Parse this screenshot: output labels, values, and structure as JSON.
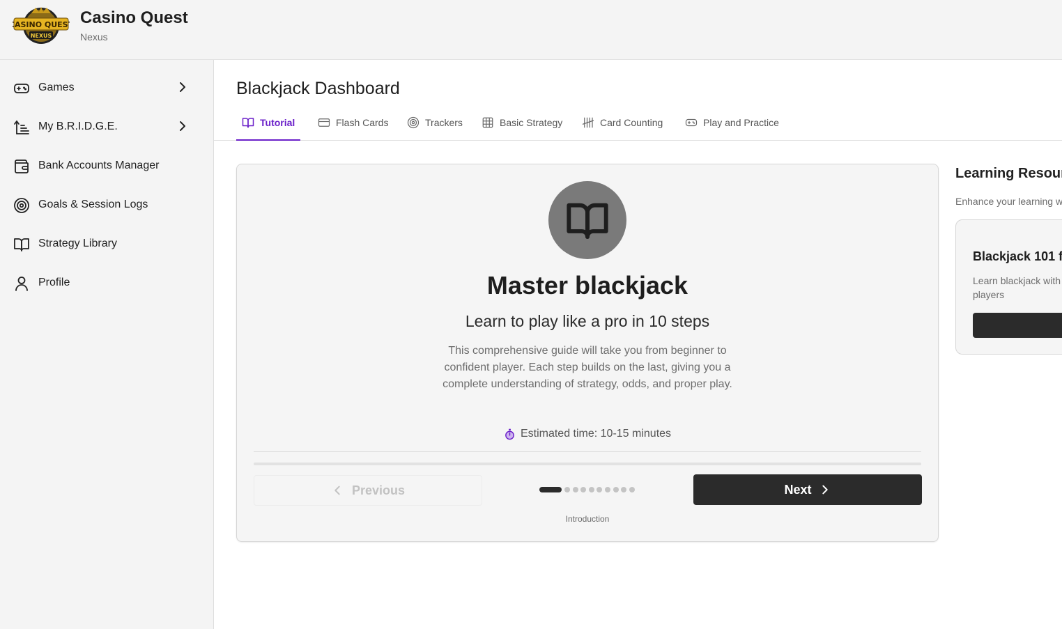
{
  "header": {
    "title": "Casino Quest",
    "subtitle": "Nexus",
    "logo_icon": "casino-quest-logo",
    "logo_text_top": "CASINO QUEST",
    "logo_text_bottom": "NEXUS"
  },
  "sidebar": {
    "items": [
      {
        "label": "Games",
        "icon": "gamepad-icon",
        "has_submenu": true
      },
      {
        "label": "My B.R.I.D.G.E.",
        "icon": "bridge-icon",
        "has_submenu": true
      },
      {
        "label": "Bank Accounts Manager",
        "icon": "wallet-icon",
        "has_submenu": false
      },
      {
        "label": "Goals & Session Logs",
        "icon": "target-icon",
        "has_submenu": false
      },
      {
        "label": "Strategy Library",
        "icon": "book-icon",
        "has_submenu": false
      },
      {
        "label": "Profile",
        "icon": "user-icon",
        "has_submenu": false
      }
    ]
  },
  "main": {
    "title": "Blackjack Dashboard",
    "tabs": [
      {
        "label": "Tutorial",
        "icon": "book-icon",
        "active": true
      },
      {
        "label": "Flash Cards",
        "icon": "card-icon",
        "active": false
      },
      {
        "label": "Trackers",
        "icon": "target-icon",
        "active": false
      },
      {
        "label": "Basic Strategy",
        "icon": "grid-icon",
        "active": false
      },
      {
        "label": "Card Counting",
        "icon": "tally-icon",
        "active": false
      },
      {
        "label": "Play and Practice",
        "icon": "gamepad-icon",
        "active": false
      }
    ]
  },
  "tutorial": {
    "icon": "book-icon",
    "title": "Master blackjack",
    "subtitle": "Learn to play like a pro in 10 steps",
    "description": "This comprehensive guide will take you from beginner to confident player. Each step builds on the last, giving you a complete understanding of strategy, odds, and proper play.",
    "estimated_time": "Estimated time: 10-15 minutes",
    "estimated_icon": "stopwatch-icon",
    "progress": 0,
    "previous_label": "Previous",
    "next_label": "Next",
    "total_steps": 10,
    "current_step": 1,
    "step_label": "Introduction"
  },
  "resources": {
    "title": "Learning Resour",
    "subtitle": "Enhance your learning wi",
    "card": {
      "title": "Blackjack 101 f",
      "description": "Learn blackjack with players"
    }
  },
  "colors": {
    "accent": "#6a1fc9",
    "dark_button": "#2b2b2b",
    "panel_bg": "#f4f4f4",
    "hero_circle": "#7a7a7a"
  }
}
